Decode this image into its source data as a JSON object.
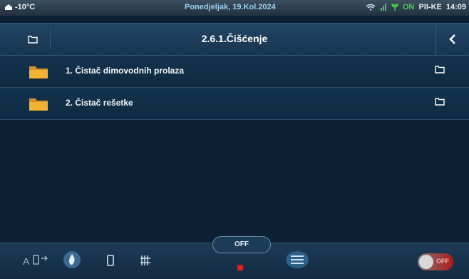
{
  "status": {
    "temperature": "-10°C",
    "date": "Ponedjeljak, 19.Kol.2024",
    "status_on": "ON",
    "device": "PII-KE",
    "time": "14:09"
  },
  "header": {
    "title": "2.6.1.Čišćenje"
  },
  "items": [
    {
      "label": "1.  Čistač dimovodnih prolaza"
    },
    {
      "label": "2.  Čistač rešetke"
    }
  ],
  "bottom": {
    "mode_label": "A",
    "off_label": "OFF",
    "toggle_label": "OFF"
  },
  "colors": {
    "background": "#0b2034",
    "folder": "#f3b233",
    "accent": "#2f5c82",
    "alarm": "#e02020"
  }
}
